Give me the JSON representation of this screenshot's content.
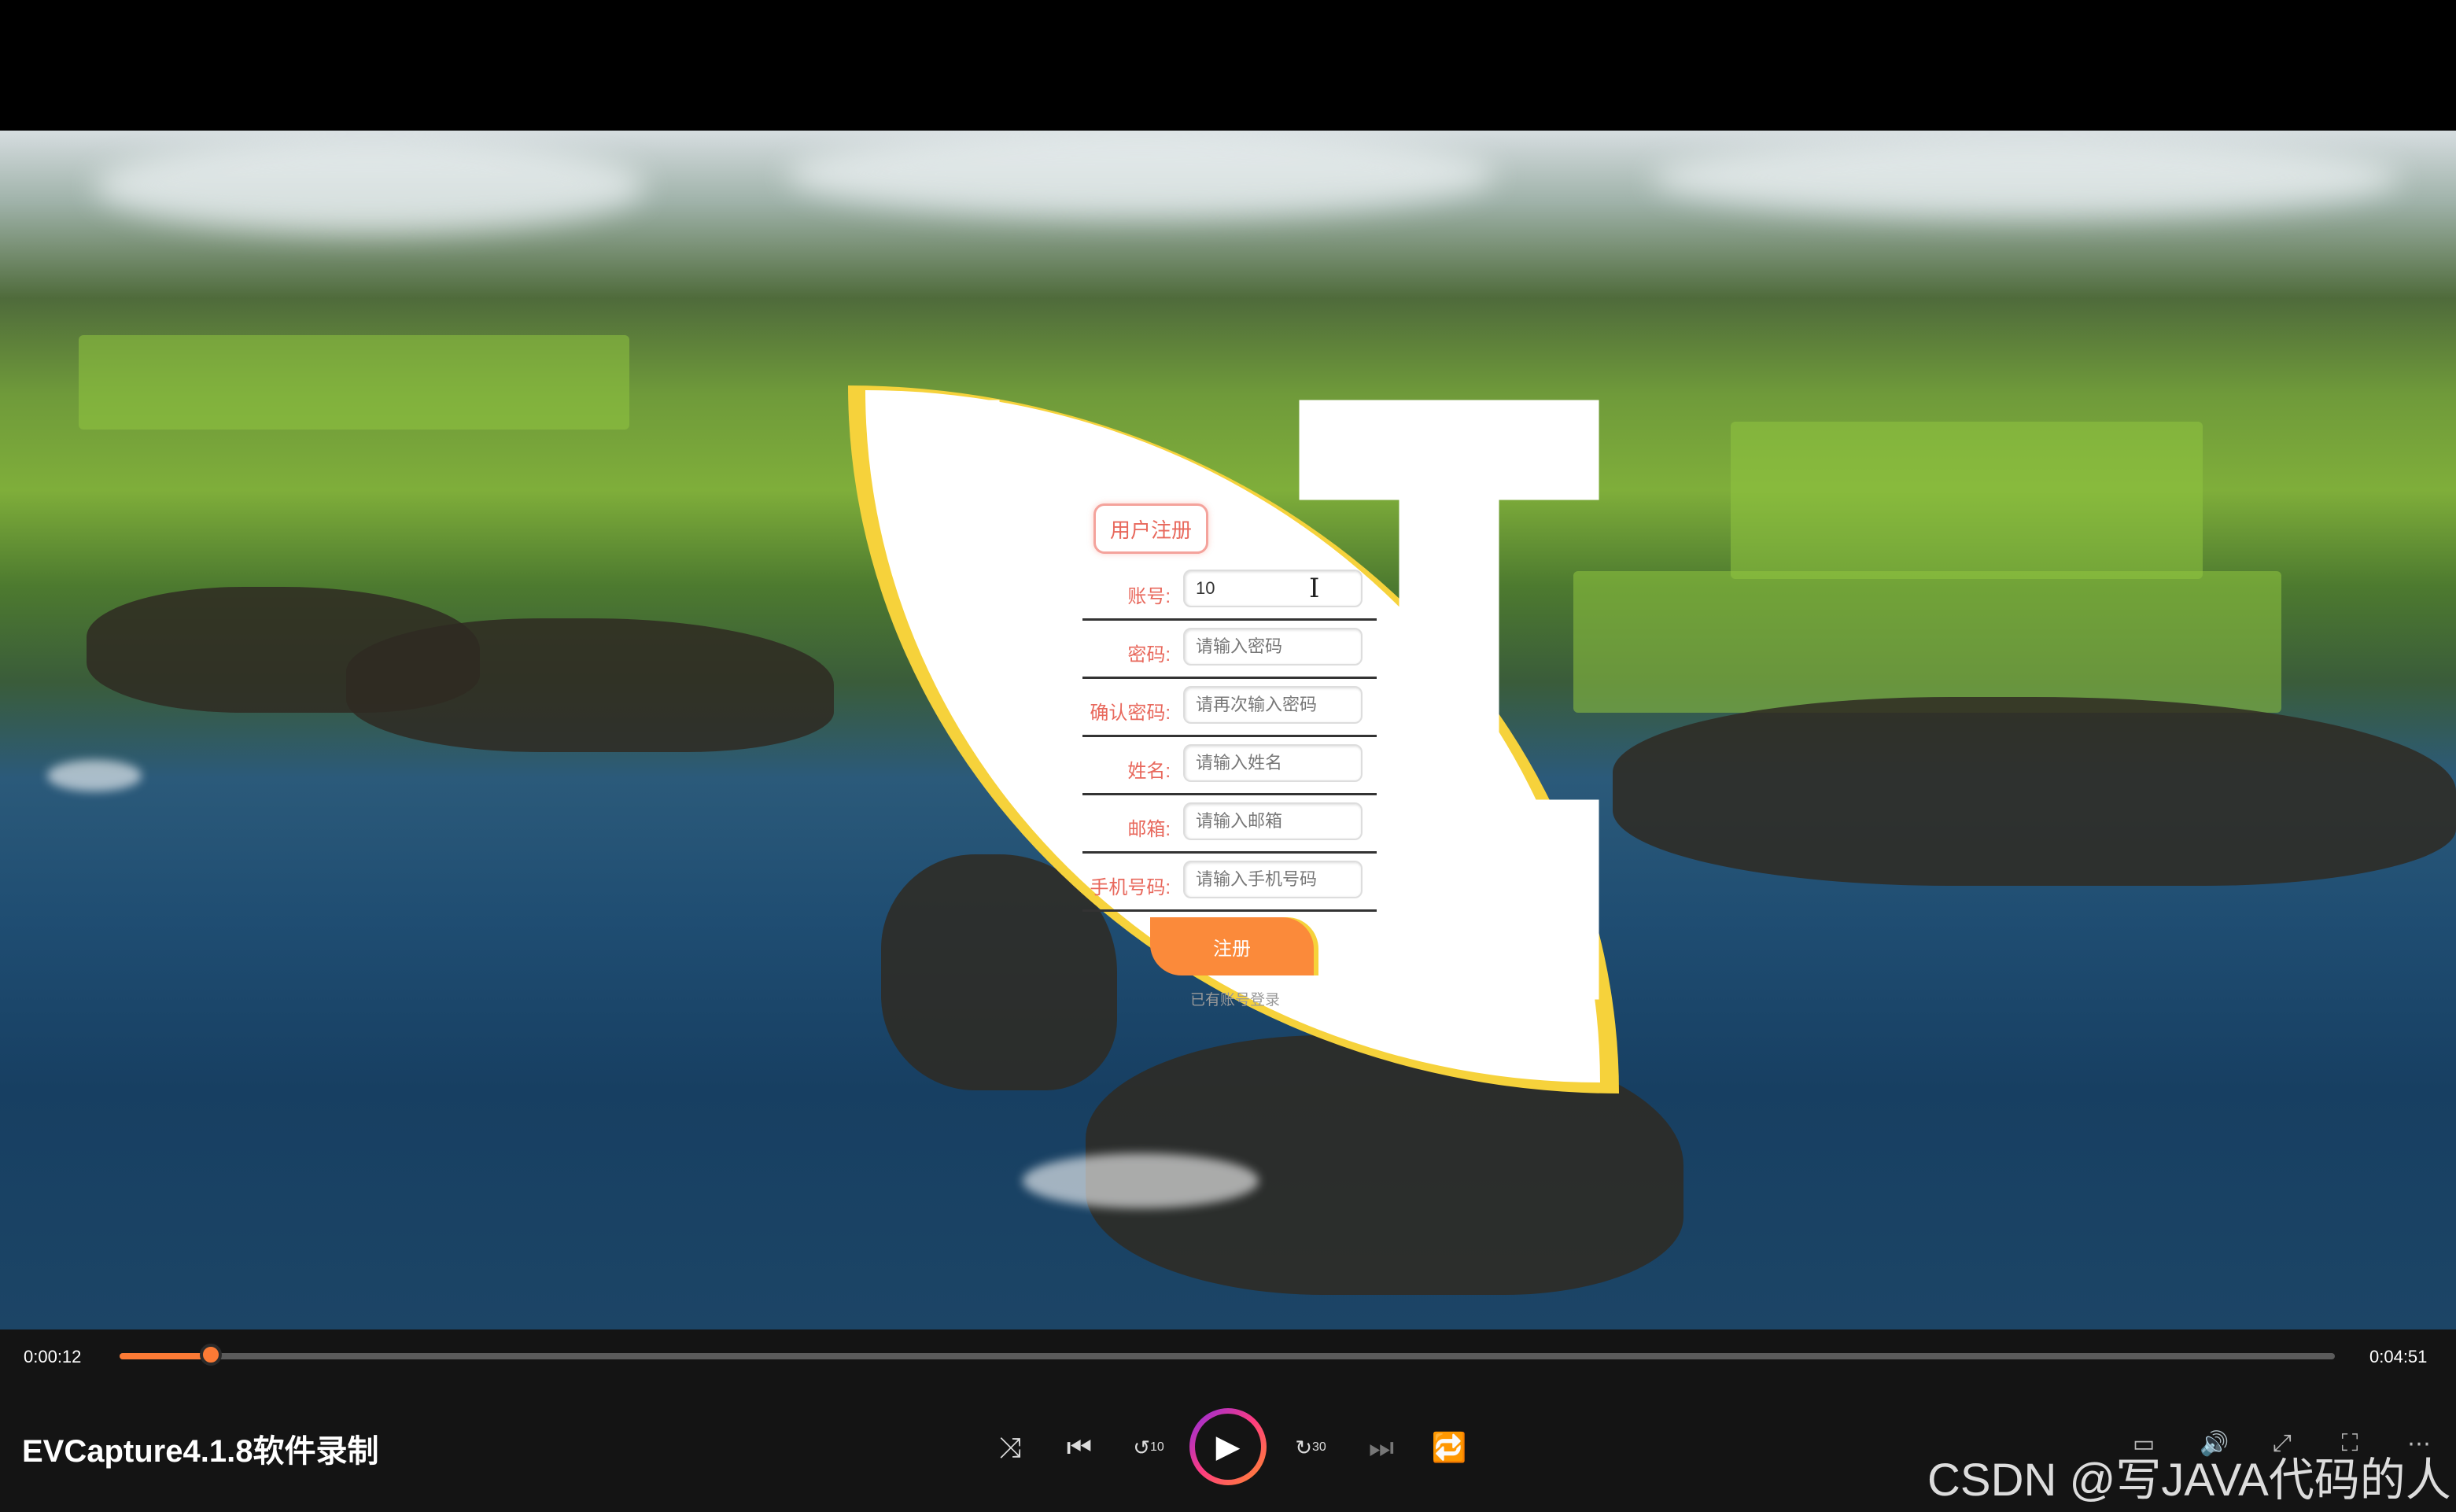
{
  "form": {
    "title": "用户注册",
    "fields": [
      {
        "label": "账号:",
        "value": "10",
        "placeholder": ""
      },
      {
        "label": "密码:",
        "value": "",
        "placeholder": "请输入密码"
      },
      {
        "label": "确认密码:",
        "value": "",
        "placeholder": "请再次输入密码"
      },
      {
        "label": "姓名:",
        "value": "",
        "placeholder": "请输入姓名"
      },
      {
        "label": "邮箱:",
        "value": "",
        "placeholder": "请输入邮箱"
      },
      {
        "label": "手机号码:",
        "value": "",
        "placeholder": "请输入手机号码"
      }
    ],
    "submit_label": "注册",
    "login_link": "已有账号登录"
  },
  "player": {
    "current_time": "0:00:12",
    "total_time": "0:04:51",
    "progress_fraction": 0.0412,
    "title": "EVCapture4.1.8软件录制",
    "icons": [
      "shuffle-icon",
      "previous-icon",
      "rewind-10-icon",
      "play-icon",
      "forward-30-icon",
      "next-icon",
      "repeat-icon",
      "subtitles-icon",
      "volume-icon",
      "expand-icon",
      "fullscreen-icon",
      "more-icon"
    ],
    "rewind_label": "10",
    "forward_label": "30"
  },
  "watermark": "CSDN @写JAVA代码的人",
  "colors": {
    "accent_orange": "#fb8a3a",
    "leaf_yellow": "#f6d23b",
    "label_red": "#e8685c"
  }
}
